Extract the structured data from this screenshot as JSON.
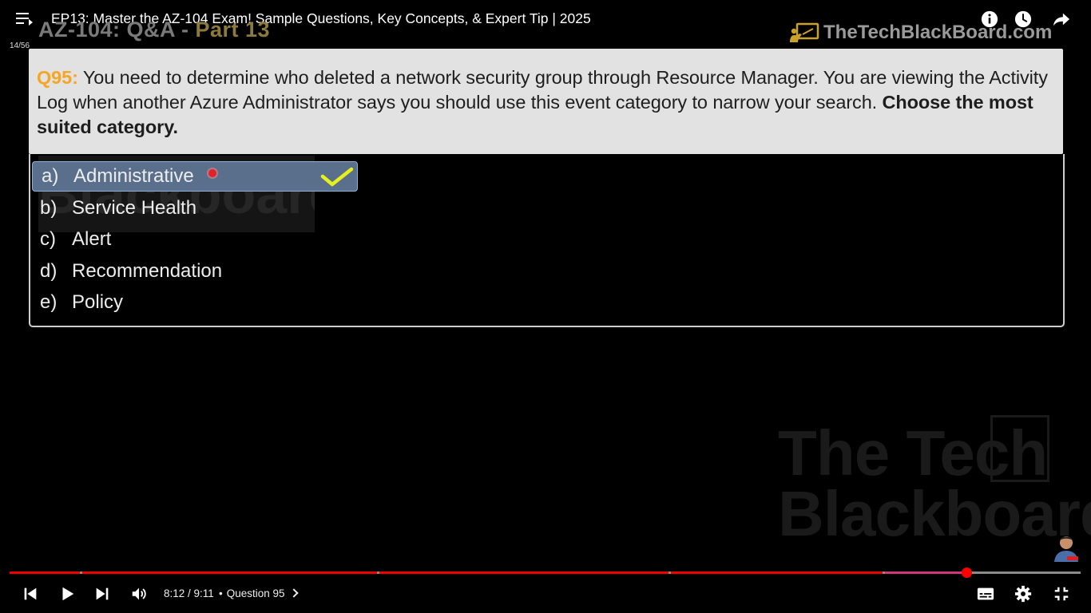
{
  "topbar": {
    "title": "EP13: Master the AZ-104 Exam! Sample Questions, Key Concepts, & Expert Tip | 2025",
    "playlist_position": "14/56"
  },
  "slide": {
    "header_main": "AZ-104: Q&A - ",
    "header_part": "Part 13",
    "brand": "TheTechBlackBoard.com"
  },
  "question": {
    "number": "Q95:",
    "text": " You need to determine who deleted a network security group through Resource Manager. You are viewing the Activity Log when another Azure Administrator says you should use this event category to narrow your search. ",
    "emphasis": "Choose the most suited category."
  },
  "options": [
    {
      "letter": "a)",
      "label": "Administrative",
      "selected": true
    },
    {
      "letter": "b)",
      "label": "Service Health",
      "selected": false
    },
    {
      "letter": "c)",
      "label": "Alert",
      "selected": false
    },
    {
      "letter": "d)",
      "label": "Recommendation",
      "selected": false
    },
    {
      "letter": "e)",
      "label": "Policy",
      "selected": false
    }
  ],
  "watermark": {
    "small": "Blackboard",
    "big_line1": "The Tech",
    "big_line2": "Blackboard"
  },
  "player": {
    "time": "8:12 / 9:11",
    "chapter": "Question 95",
    "progress": 0.897
  },
  "icons": {
    "menu": "playlist-menu-icon",
    "info": "info-icon",
    "watch_later": "clock-icon",
    "share": "share-icon",
    "prev": "skip-previous-icon",
    "play": "play-icon",
    "next": "skip-next-icon",
    "volume": "volume-icon",
    "captions": "subtitles-icon",
    "settings": "gear-icon",
    "exit_fullscreen": "exit-fullscreen-icon"
  },
  "colors": {
    "question_number": "#f5a623",
    "selected_option": "#5a6f8c",
    "checkmark": "#e6f01e",
    "progress_played": "#ff0000"
  }
}
